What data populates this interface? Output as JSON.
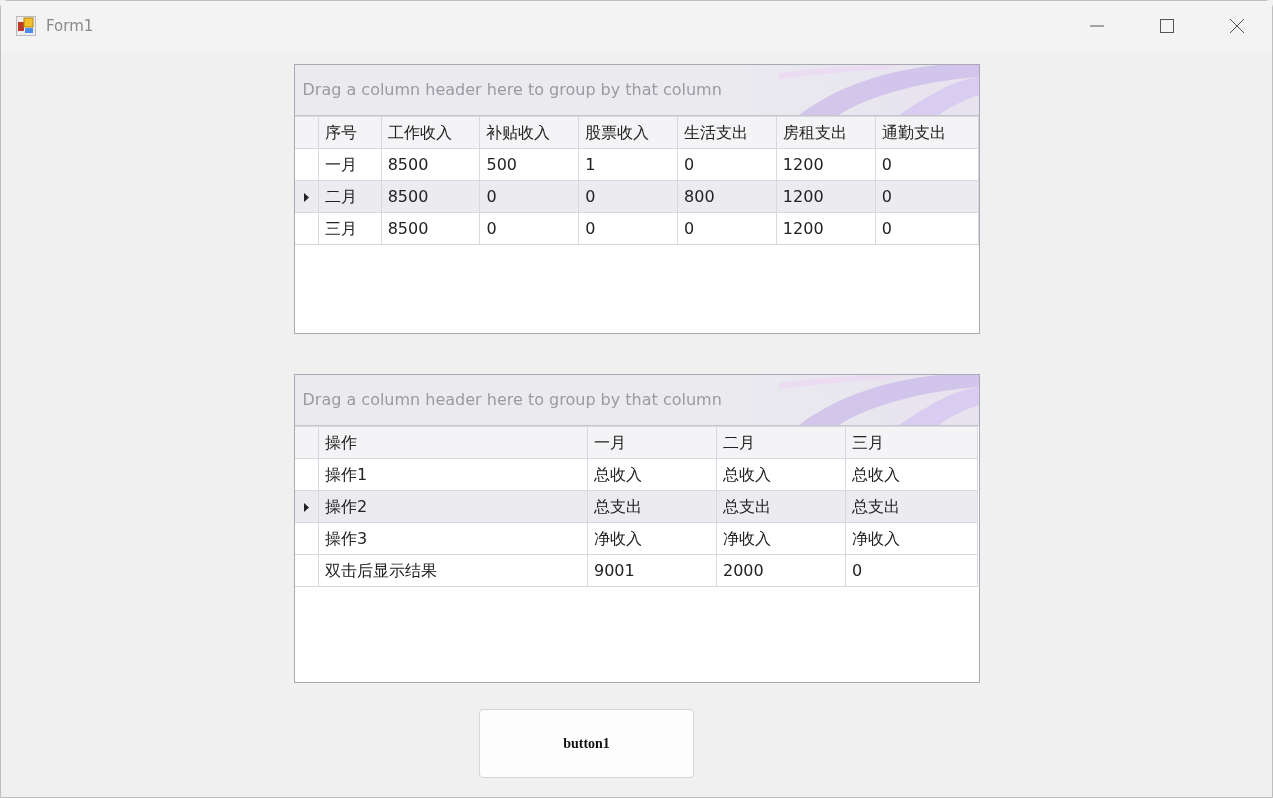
{
  "window": {
    "title": "Form1"
  },
  "grids": [
    {
      "group_panel": "Drag a column header here to group by that column",
      "columns": [
        "序号",
        "工作收入",
        "补贴收入",
        "股票收入",
        "生活支出",
        "房租支出",
        "通勤支出"
      ],
      "rows": [
        {
          "selected": false,
          "cells": [
            "一月",
            "8500",
            "500",
            "1",
            "0",
            "1200",
            "0"
          ]
        },
        {
          "selected": true,
          "cells": [
            "二月",
            "8500",
            "0",
            "0",
            "800",
            "1200",
            "0"
          ]
        },
        {
          "selected": false,
          "cells": [
            "三月",
            "8500",
            "0",
            "0",
            "0",
            "1200",
            "0"
          ]
        }
      ]
    },
    {
      "group_panel": "Drag a column header here to group by that column",
      "columns": [
        "操作",
        "一月",
        "二月",
        "三月"
      ],
      "rows": [
        {
          "selected": false,
          "cells": [
            "操作1",
            "总收入",
            "总收入",
            "总收入"
          ]
        },
        {
          "selected": true,
          "cells": [
            "操作2",
            "总支出",
            "总支出",
            "总支出"
          ]
        },
        {
          "selected": false,
          "cells": [
            "操作3",
            "净收入",
            "净收入",
            "净收入"
          ]
        },
        {
          "selected": false,
          "cells": [
            "双击后显示结果",
            "9001",
            "2000",
            "0"
          ]
        }
      ]
    }
  ],
  "button": "button1"
}
